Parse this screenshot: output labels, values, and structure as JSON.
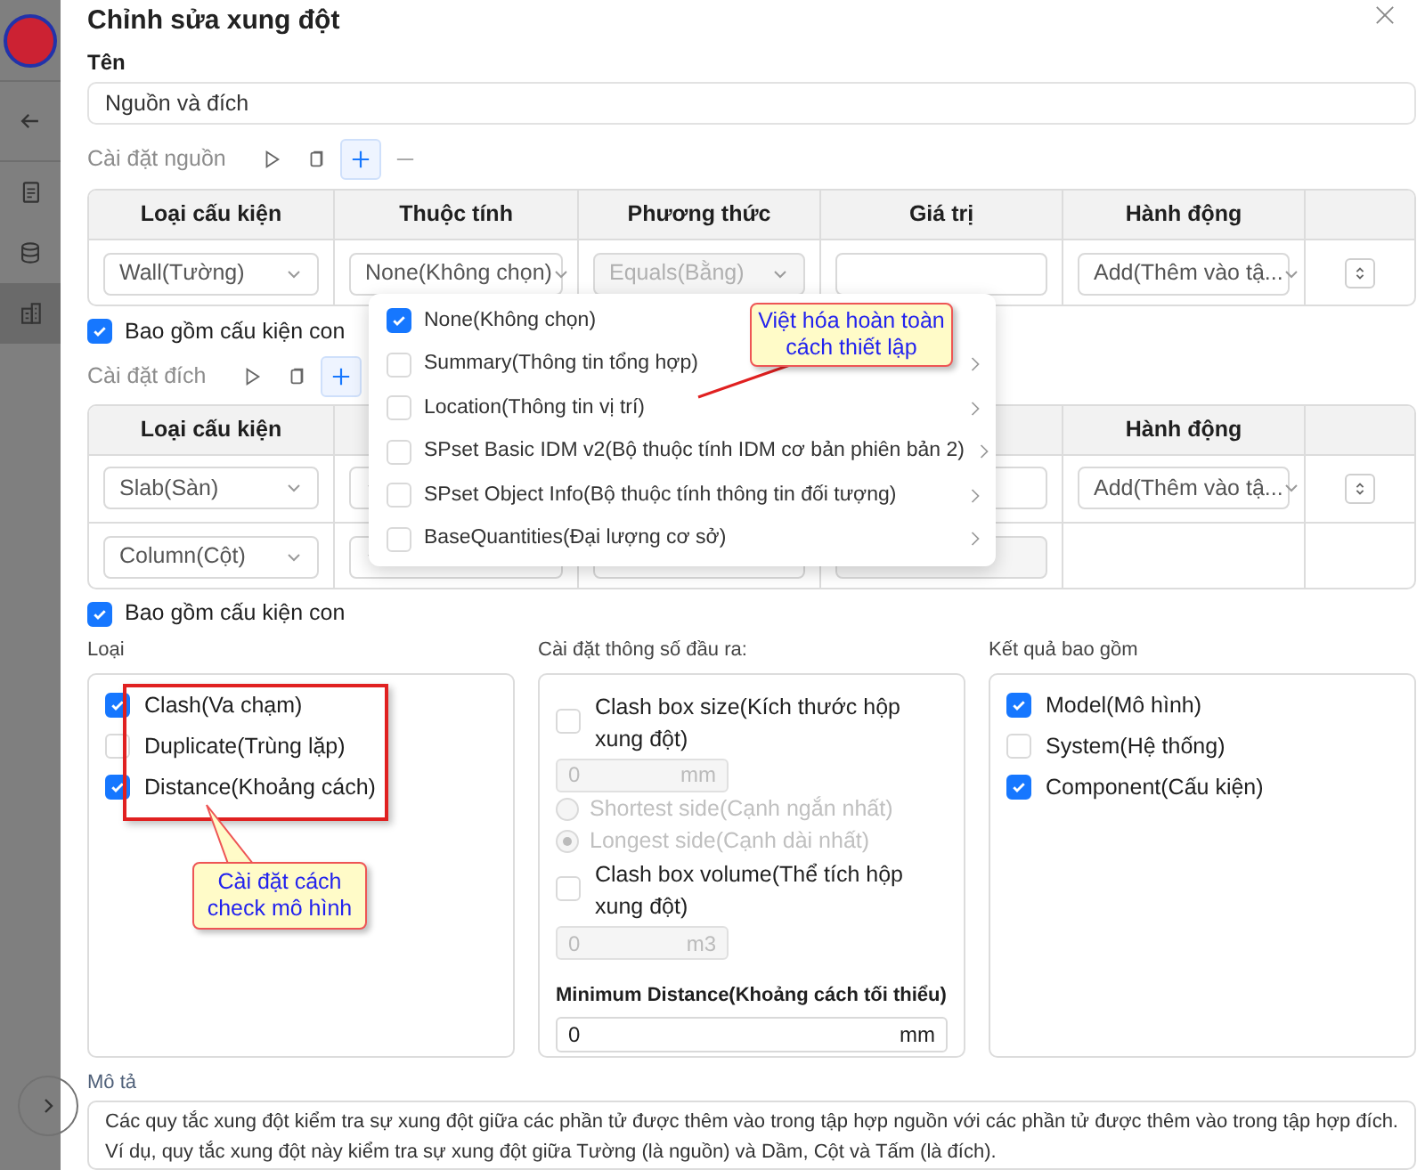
{
  "sidebar": {
    "items": [
      {
        "kind": "back",
        "selected": false
      },
      {
        "kind": "document",
        "selected": false
      },
      {
        "kind": "database",
        "selected": false
      },
      {
        "kind": "building",
        "selected": true
      }
    ]
  },
  "dialog": {
    "title": "Chỉnh sửa xung đột",
    "name_label": "Tên",
    "name_value": "Nguồn và đích"
  },
  "source": {
    "label": "Cài đặt nguồn",
    "columns": [
      "Loại cấu kiện",
      "Thuộc tính",
      "Phương thức",
      "Giá trị",
      "Hành động"
    ],
    "row": {
      "component": "Wall(Tường)",
      "property": "None(Không chọn)",
      "method": {
        "text": "Equals(Bằng)",
        "disabled": true
      },
      "action": "Add(Thêm vào tậ..."
    },
    "include_children": {
      "label": "Bao gồm cấu kiện con",
      "checked": true
    }
  },
  "target": {
    "label": "Cài đặt đích",
    "columns": {
      "component": "Loại cấu kiện",
      "action": "Hành động"
    },
    "rows": [
      {
        "component": "Slab(Sàn)",
        "action": "Add(Thêm vào tậ..."
      },
      {
        "component": "Column(Cột)"
      }
    ],
    "include_children": {
      "label": "Bao gồm cấu kiện con",
      "checked": true
    }
  },
  "property_dropdown": {
    "items": [
      {
        "label": "None(Không chọn)",
        "checked": true,
        "submenu": false
      },
      {
        "label": "Summary(Thông tin tổng hợp)",
        "checked": false,
        "submenu": true
      },
      {
        "label": "Location(Thông tin vị trí)",
        "checked": false,
        "submenu": true
      },
      {
        "label": "SPset Basic IDM v2(Bộ thuộc tính IDM cơ bản phiên bản 2)",
        "checked": false,
        "submenu": true
      },
      {
        "label": "SPset Object Info(Bộ thuộc tính thông tin đối tượng)",
        "checked": false,
        "submenu": true
      },
      {
        "label": "BaseQuantities(Đại lượng cơ sở)",
        "checked": false,
        "submenu": true
      }
    ]
  },
  "types": {
    "label": "Loại",
    "items": [
      {
        "label": "Clash(Va chạm)",
        "checked": true
      },
      {
        "label": "Duplicate(Trùng lặp)",
        "checked": false
      },
      {
        "label": "Distance(Khoảng cách)",
        "checked": true
      }
    ]
  },
  "output": {
    "label": "Cài đặt thông số đầu ra:",
    "clash_box_size": {
      "label": "Clash box size(Kích thước hộp xung đột)",
      "checked": false,
      "value": "0",
      "unit": "mm"
    },
    "sides": [
      {
        "label": "Shortest side(Cạnh ngắn nhất)",
        "selected": false
      },
      {
        "label": "Longest side(Cạnh dài nhất)",
        "selected": true
      }
    ],
    "clash_box_volume": {
      "label": "Clash box volume(Thể tích hộp xung đột)",
      "checked": false,
      "value": "0",
      "unit": "m3"
    },
    "min_distance": {
      "label": "Minimum Distance(Khoảng cách tối thiểu)",
      "value": "0",
      "unit": "mm"
    }
  },
  "results": {
    "label": "Kết quả bao gồm",
    "items": [
      {
        "label": "Model(Mô hình)",
        "checked": true
      },
      {
        "label": "System(Hệ thống)",
        "checked": false
      },
      {
        "label": "Component(Cấu kiện)",
        "checked": true
      }
    ]
  },
  "description": {
    "label": "Mô tả",
    "lines": [
      "Các quy tắc xung đột kiểm tra sự xung đột giữa các phần tử được thêm vào trong tập hợp nguồn với các phần tử được thêm vào trong tập hợp đích.",
      "Ví dụ, quy tắc xung đột này kiểm tra sự xung đột giữa Tường (là nguồn) và Dầm, Cột và Tấm (là đích)."
    ]
  },
  "annotations": [
    {
      "text": "Việt hóa hoàn toàn cách thiết lập"
    },
    {
      "text": "Cài đặt cách check mô hình"
    }
  ]
}
